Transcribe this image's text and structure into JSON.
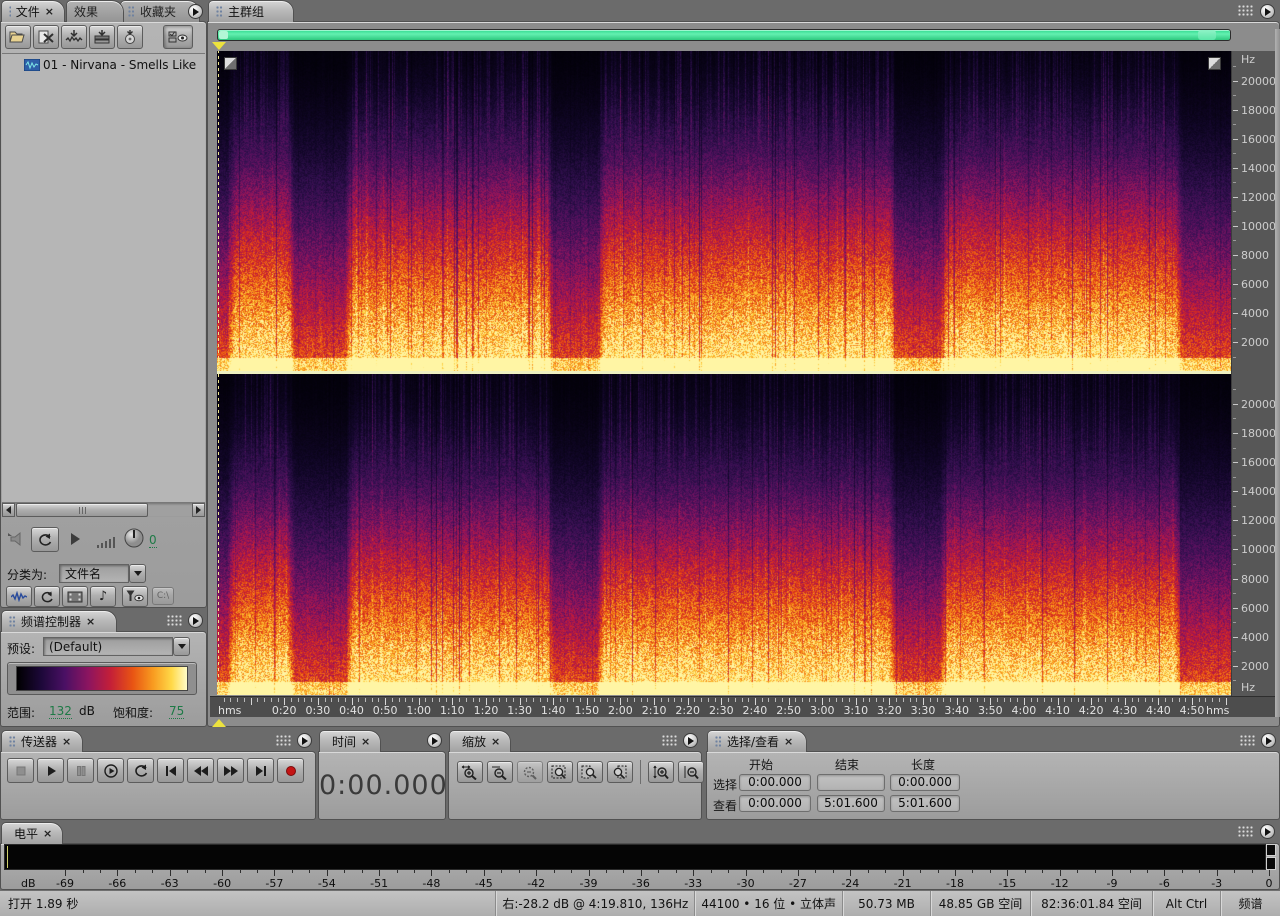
{
  "app": {
    "close_glyph": "×",
    "accent_green": "#3fe09a",
    "playhead_yellow": "#ece23e",
    "record_red": "#c41414",
    "value_green": "#1e7a46"
  },
  "file_panel": {
    "tabs": [
      {
        "label": "文件",
        "active": true,
        "closable": true
      },
      {
        "label": "效果",
        "active": false
      },
      {
        "label": "收藏夹",
        "active": false
      }
    ],
    "toolbar_icons": [
      "open-file",
      "close-file",
      "import-file",
      "insert-into-multitrack",
      "insert-into-cd",
      "show-options"
    ],
    "files": [
      {
        "name": "01 - Nirvana - Smells Like",
        "selected": true
      }
    ],
    "playback_icons": [
      "auto-play-speaker",
      "loop-playback",
      "play-file",
      "volume-bars",
      "volume-knob"
    ],
    "auto_play_volume": "0",
    "sort_label": "分类为:",
    "sort_value": "文件名",
    "toggle_icons": [
      "show-audio-files",
      "show-loop-files",
      "show-video-files",
      "show-midi-files",
      "filter-view",
      "drive"
    ],
    "drive_button": "C:\\"
  },
  "spectral_controls": {
    "title": "频谱控制器",
    "preset_label": "预设:",
    "preset_value": "(Default)",
    "range_label": "范围:",
    "range_value": "132",
    "range_unit": "dB",
    "saturation_label": "饱和度:",
    "saturation_value": "75",
    "gradient_stops": [
      "#000000",
      "#1c0838",
      "#4a1064",
      "#8c1560",
      "#c41f38",
      "#e85413",
      "#f89b20",
      "#ffd948",
      "#fffdc8"
    ]
  },
  "main_view": {
    "tab": "主群组",
    "freq_unit": "Hz",
    "freq_labels": [
      20000,
      18000,
      16000,
      14000,
      12000,
      10000,
      8000,
      6000,
      4000,
      2000
    ],
    "freq_max": 22050,
    "time_unit": "hms",
    "time_labels": [
      "0:20",
      "0:30",
      "0:40",
      "0:50",
      "1:00",
      "1:10",
      "1:20",
      "1:30",
      "1:40",
      "1:50",
      "2:00",
      "2:10",
      "2:20",
      "2:30",
      "2:40",
      "2:50",
      "3:00",
      "3:10",
      "3:20",
      "3:30",
      "3:40",
      "3:50",
      "4:00",
      "4:10",
      "4:20",
      "4:30",
      "4:40",
      "4:50"
    ],
    "first_label_seconds": 20,
    "label_step_seconds": 10,
    "duration_seconds": 301.6
  },
  "spectrogram": {
    "channels": 2,
    "duration_seconds": 301.6,
    "quiet_regions": [
      [
        0,
        3
      ],
      [
        23,
        38
      ],
      [
        100,
        113
      ],
      [
        202,
        215
      ],
      [
        287,
        302
      ]
    ],
    "palette": [
      "#000004",
      "#120729",
      "#331050",
      "#5d1260",
      "#8d155e",
      "#b61845",
      "#d52b21",
      "#e95413",
      "#f58119",
      "#fcb028",
      "#ffd94e",
      "#fff7a8"
    ]
  },
  "transport": {
    "title": "传送器",
    "buttons": [
      "stop",
      "play",
      "pause",
      "play-from-cursor",
      "play-looped",
      "go-to-beginning",
      "rewind",
      "fast-forward",
      "go-to-end",
      "record"
    ]
  },
  "time_panel": {
    "title": "时间",
    "value": "0:00.000"
  },
  "zoom_panel": {
    "title": "缩放",
    "buttons": [
      "zoom-in-horizontal",
      "zoom-out-horizontal",
      "zoom-out-full",
      "zoom-to-selection",
      "zoom-selection-left",
      "zoom-selection-right",
      "zoom-in-vertical",
      "zoom-out-vertical"
    ]
  },
  "selection_view": {
    "title": "选择/查看",
    "columns": [
      "开始",
      "结束",
      "长度"
    ],
    "rows": [
      {
        "label": "选择",
        "start": "0:00.000",
        "end": "",
        "length": "0:00.000"
      },
      {
        "label": "查看",
        "start": "0:00.000",
        "end": "5:01.600",
        "length": "5:01.600"
      }
    ]
  },
  "levels": {
    "title": "电平",
    "unit": "dB",
    "ticks": [
      "-69",
      "-66",
      "-63",
      "-60",
      "-57",
      "-54",
      "-51",
      "-48",
      "-45",
      "-42",
      "-39",
      "-36",
      "-33",
      "-30",
      "-27",
      "-24",
      "-21",
      "-18",
      "-15",
      "-12",
      "-9",
      "-6",
      "-3",
      "0"
    ]
  },
  "status_bar": {
    "left": "打开 1.89 秒",
    "segments": [
      "右:-28.2 dB @ 4:19.810, 136Hz",
      "44100 • 16 位 • 立体声",
      "50.73 MB",
      "48.85 GB 空间",
      "82:36:01.84 空间",
      "Alt Ctrl",
      "频谱"
    ]
  }
}
